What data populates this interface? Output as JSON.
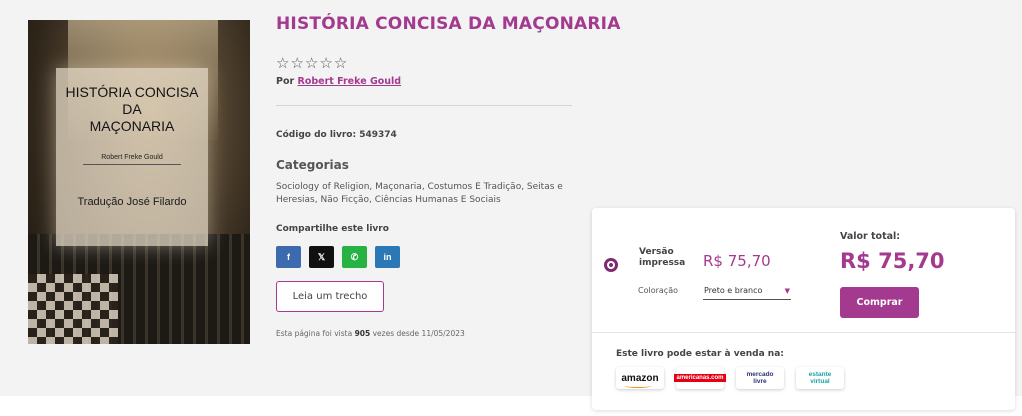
{
  "book": {
    "title": "HISTÓRIA CONCISA DA MAÇONARIA",
    "rating_stars": 0,
    "rating_max": 5,
    "author_prefix": "Por",
    "author_name": "Robert Freke Gould",
    "code_text": "Código do livro: 549374",
    "categories_heading": "Categorias",
    "categories_text": "Sociology of Religion, Maçonaria, Costumos E Tradição, Seitas e Heresias, Não Ficção, Ciências Humanas E Sociais",
    "share_heading": "Compartilhe este livro",
    "share_buttons": [
      {
        "network": "facebook",
        "glyph": "f"
      },
      {
        "network": "x",
        "glyph": "𝕏"
      },
      {
        "network": "whatsapp",
        "glyph": "✆"
      },
      {
        "network": "linkedin",
        "glyph": "in"
      }
    ],
    "excerpt_button": "Leia um trecho",
    "views": {
      "prefix": "Esta página foi vista",
      "count": "905",
      "suffix": "vezes desde 11/05/2023"
    }
  },
  "cover": {
    "title_line1": "HISTÓRIA CONCISA",
    "title_line2": "DA",
    "title_line3": "MAÇONARIA",
    "author": "Robert Freke Gould",
    "translation": "Tradução José Filardo"
  },
  "purchase": {
    "version_label": "Versão impressa",
    "version_price": "R$ 75,70",
    "color_label": "Coloração",
    "color_value": "Preto e branco",
    "total_label": "Valor total:",
    "total_price": "R$ 75,70",
    "buy_button": "Comprar",
    "sale_heading": "Este livro pode estar à venda na:",
    "stores": [
      {
        "name": "amazon",
        "label": "amazon"
      },
      {
        "name": "americanas",
        "label": "americanas.com"
      },
      {
        "name": "mercado-livre",
        "label_line1": "mercado",
        "label_line2": "livre"
      },
      {
        "name": "estante-virtual",
        "label_line1": "estante",
        "label_line2": "virtual"
      }
    ]
  },
  "colors": {
    "brand": "#a33a8f",
    "radio": "#7d2a72",
    "facebook": "#3b6aae",
    "x": "#111111",
    "whatsapp": "#27b244",
    "linkedin": "#2a78b5"
  }
}
